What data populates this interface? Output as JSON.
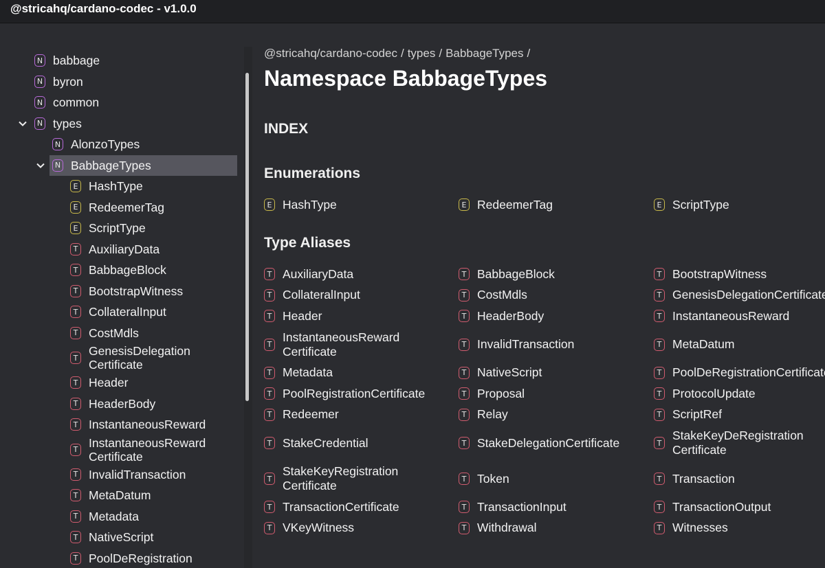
{
  "app_title": "@stricahq/cardano-codec - v1.0.0",
  "sidebar": {
    "items": [
      {
        "kind": "N",
        "label": "babbage",
        "indent": 0
      },
      {
        "kind": "N",
        "label": "byron",
        "indent": 0
      },
      {
        "kind": "N",
        "label": "common",
        "indent": 0
      },
      {
        "kind": "N",
        "label": "types",
        "indent": 0,
        "expanded": true
      },
      {
        "kind": "N",
        "label": "AlonzoTypes",
        "indent": 1
      },
      {
        "kind": "N",
        "label": "BabbageTypes",
        "indent": 1,
        "expanded": true,
        "active": true
      },
      {
        "kind": "E",
        "label": "HashType",
        "indent": 2
      },
      {
        "kind": "E",
        "label": "RedeemerTag",
        "indent": 2
      },
      {
        "kind": "E",
        "label": "ScriptType",
        "indent": 2
      },
      {
        "kind": "T",
        "label": "AuxiliaryData",
        "indent": 2
      },
      {
        "kind": "T",
        "label": "BabbageBlock",
        "indent": 2
      },
      {
        "kind": "T",
        "label": "BootstrapWitness",
        "indent": 2
      },
      {
        "kind": "T",
        "label": "CollateralInput",
        "indent": 2
      },
      {
        "kind": "T",
        "label": "CostMdls",
        "indent": 2
      },
      {
        "kind": "T",
        "label": "GenesisDelegation\nCertificate",
        "indent": 2
      },
      {
        "kind": "T",
        "label": "Header",
        "indent": 2
      },
      {
        "kind": "T",
        "label": "HeaderBody",
        "indent": 2
      },
      {
        "kind": "T",
        "label": "InstantaneousReward",
        "indent": 2
      },
      {
        "kind": "T",
        "label": "InstantaneousReward\nCertificate",
        "indent": 2
      },
      {
        "kind": "T",
        "label": "InvalidTransaction",
        "indent": 2
      },
      {
        "kind": "T",
        "label": "MetaDatum",
        "indent": 2
      },
      {
        "kind": "T",
        "label": "Metadata",
        "indent": 2
      },
      {
        "kind": "T",
        "label": "NativeScript",
        "indent": 2
      },
      {
        "kind": "T",
        "label": "PoolDeRegistration",
        "indent": 2
      }
    ]
  },
  "breadcrumb": [
    "@stricahq/cardano-codec",
    "types",
    "BabbageTypes"
  ],
  "page_title": "Namespace BabbageTypes",
  "index_heading": "INDEX",
  "enumerations": {
    "heading": "Enumerations",
    "items": [
      "HashType",
      "RedeemerTag",
      "ScriptType"
    ]
  },
  "type_aliases": {
    "heading": "Type Aliases",
    "rows": [
      [
        "AuxiliaryData",
        "BabbageBlock",
        "BootstrapWitness"
      ],
      [
        "CollateralInput",
        "CostMdls",
        "GenesisDelegationCertificate"
      ],
      [
        "Header",
        "HeaderBody",
        "InstantaneousReward"
      ],
      [
        "InstantaneousReward\nCertificate",
        "InvalidTransaction",
        "MetaDatum"
      ],
      [
        "Metadata",
        "NativeScript",
        "PoolDeRegistrationCertificate"
      ],
      [
        "PoolRegistrationCertificate",
        "Proposal",
        "ProtocolUpdate"
      ],
      [
        "Redeemer",
        "Relay",
        "ScriptRef"
      ],
      [
        "StakeCredential",
        "StakeDelegationCertificate",
        "StakeKeyDeRegistration\nCertificate"
      ],
      [
        "StakeKeyRegistration\nCertificate",
        "Token",
        "Transaction"
      ],
      [
        "TransactionCertificate",
        "TransactionInput",
        "TransactionOutput"
      ],
      [
        "VKeyWitness",
        "Withdrawal",
        "Witnesses"
      ]
    ]
  },
  "colors": {
    "namespace_badge": "#b86ad9",
    "enum_badge": "#c9b94a",
    "type_badge": "#d15c6f",
    "active_row": "#56565e",
    "background": "#2b2c30"
  },
  "icons": {
    "expand": "chevron-down-icon",
    "namespace": "namespace-badge-icon",
    "enum": "enum-badge-icon",
    "type_alias": "type-alias-badge-icon"
  }
}
